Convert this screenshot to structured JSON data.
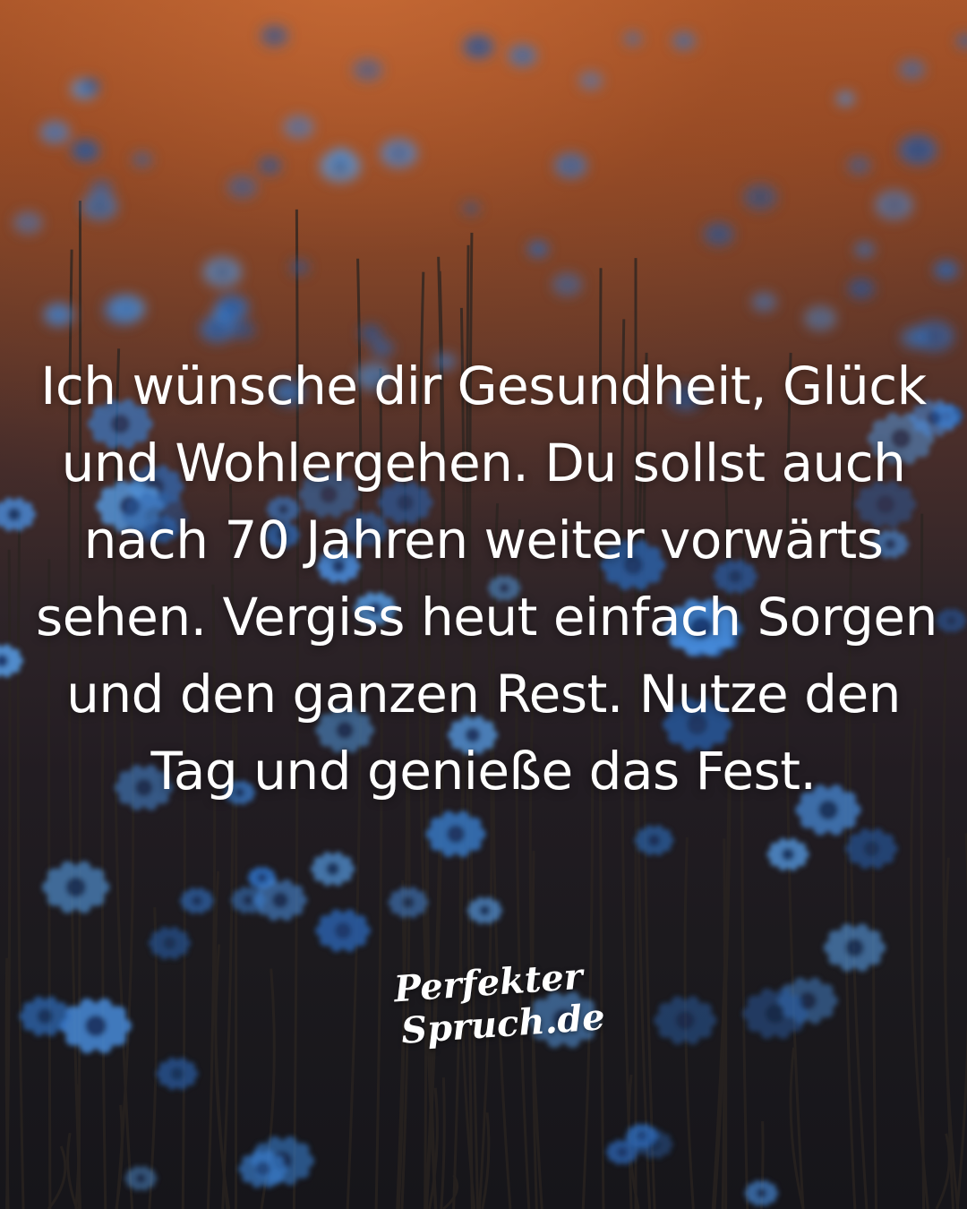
{
  "quote": {
    "lines": [
      "Ich wünsche dir Gesundheit, Glück",
      "und Wohlergehen. Du sollst auch",
      "nach 70 Jahren weiter vorwärts",
      "sehen. Vergiss heut einfach Sorgen",
      "und den ganzen Rest. Nutze den",
      "Tag und genieße das Fest."
    ]
  },
  "logo": {
    "line1": "Perfekter",
    "line2": "Spruch.de"
  },
  "colors": {
    "sky_top": "#a8552a",
    "ground": "#16151a",
    "flower": "#3a7fd0",
    "text": "#ffffff"
  }
}
